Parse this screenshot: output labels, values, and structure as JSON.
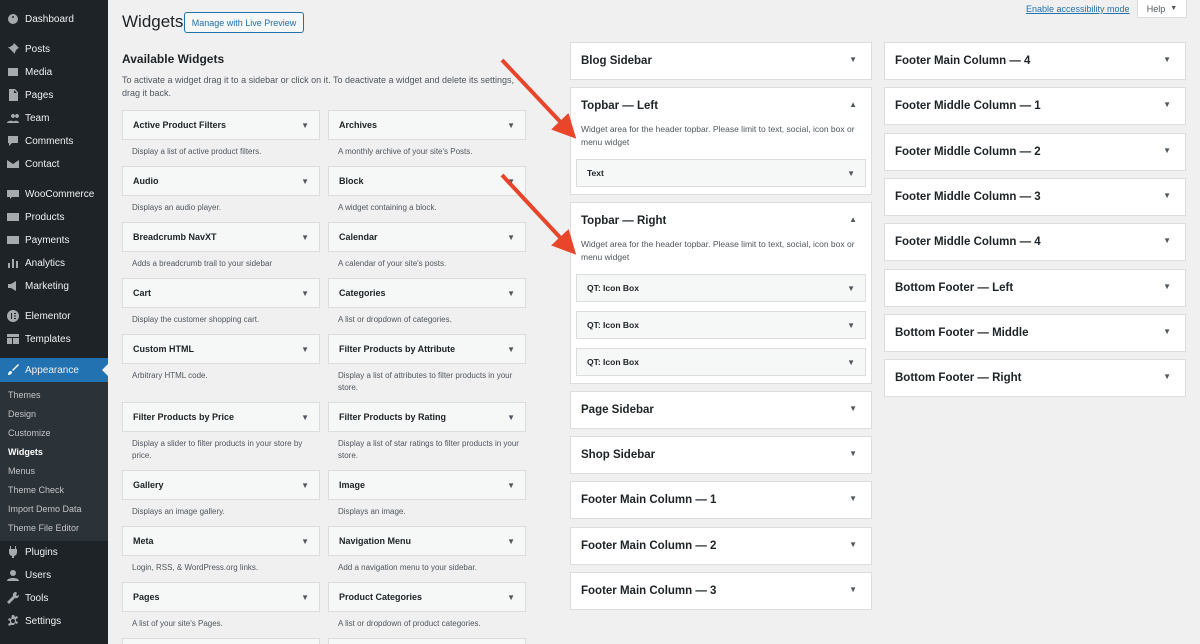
{
  "menu": {
    "items": [
      {
        "label": "Dashboard",
        "icon": "dashboard-icon"
      },
      {
        "label": "Posts",
        "icon": "pin-icon"
      },
      {
        "label": "Media",
        "icon": "media-icon"
      },
      {
        "label": "Pages",
        "icon": "pages-icon"
      },
      {
        "label": "Team",
        "icon": "team-icon"
      },
      {
        "label": "Comments",
        "icon": "comments-icon"
      },
      {
        "label": "Contact",
        "icon": "mail-icon"
      },
      {
        "label": "WooCommerce",
        "icon": "woocommerce-icon"
      },
      {
        "label": "Products",
        "icon": "products-icon"
      },
      {
        "label": "Payments",
        "icon": "payments-icon"
      },
      {
        "label": "Analytics",
        "icon": "analytics-icon"
      },
      {
        "label": "Marketing",
        "icon": "marketing-icon"
      },
      {
        "label": "Elementor",
        "icon": "elementor-icon"
      },
      {
        "label": "Templates",
        "icon": "templates-icon"
      },
      {
        "label": "Appearance",
        "icon": "brush-icon"
      },
      {
        "label": "Plugins",
        "icon": "plugins-icon"
      },
      {
        "label": "Users",
        "icon": "users-icon"
      },
      {
        "label": "Tools",
        "icon": "tools-icon"
      },
      {
        "label": "Settings",
        "icon": "settings-icon"
      }
    ],
    "submenu": [
      "Themes",
      "Design",
      "Customize",
      "Widgets",
      "Menus",
      "Theme Check",
      "Import Demo Data",
      "Theme File Editor"
    ]
  },
  "header": {
    "title": "Widgets",
    "live_preview": "Manage with Live Preview",
    "accessibility": "Enable accessibility mode",
    "help": "Help"
  },
  "available": {
    "title": "Available Widgets",
    "description": "To activate a widget drag it to a sidebar or click on it. To deactivate a widget and delete its settings, drag it back.",
    "widgets": [
      {
        "name": "Active Product Filters",
        "desc": "Display a list of active product filters."
      },
      {
        "name": "Archives",
        "desc": "A monthly archive of your site's Posts."
      },
      {
        "name": "Audio",
        "desc": "Displays an audio player."
      },
      {
        "name": "Block",
        "desc": "A widget containing a block."
      },
      {
        "name": "Breadcrumb NavXT",
        "desc": "Adds a breadcrumb trail to your sidebar"
      },
      {
        "name": "Calendar",
        "desc": "A calendar of your site's posts."
      },
      {
        "name": "Cart",
        "desc": "Display the customer shopping cart."
      },
      {
        "name": "Categories",
        "desc": "A list or dropdown of categories."
      },
      {
        "name": "Custom HTML",
        "desc": "Arbitrary HTML code."
      },
      {
        "name": "Filter Products by Attribute",
        "desc": "Display a list of attributes to filter products in your store."
      },
      {
        "name": "Filter Products by Price",
        "desc": "Display a slider to filter products in your store by price."
      },
      {
        "name": "Filter Products by Rating",
        "desc": "Display a list of star ratings to filter products in your store."
      },
      {
        "name": "Gallery",
        "desc": "Displays an image gallery."
      },
      {
        "name": "Image",
        "desc": "Displays an image."
      },
      {
        "name": "Meta",
        "desc": "Login, RSS, & WordPress.org links."
      },
      {
        "name": "Navigation Menu",
        "desc": "Add a navigation menu to your sidebar."
      },
      {
        "name": "Pages",
        "desc": "A list of your site's Pages."
      },
      {
        "name": "Product Categories",
        "desc": "A list or dropdown of product categories."
      }
    ]
  },
  "sidebars": {
    "blog": "Blog Sidebar",
    "topbar_left": {
      "title": "Topbar — Left",
      "desc": "Widget area for the header topbar. Please limit to text, social, icon box or menu widget",
      "widget": "Text"
    },
    "topbar_right": {
      "title": "Topbar — Right",
      "desc": "Widget area for the header topbar. Please limit to text, social, icon box or menu widget",
      "widgets": [
        "QT: Icon Box",
        "QT: Icon Box",
        "QT: Icon Box"
      ]
    },
    "col2": [
      "Page Sidebar",
      "Shop Sidebar",
      "Footer Main Column — 1",
      "Footer Main Column — 2",
      "Footer Main Column — 3"
    ],
    "col3": [
      "Footer Main Column — 4",
      "Footer Middle Column — 1",
      "Footer Middle Column — 2",
      "Footer Middle Column — 3",
      "Footer Middle Column — 4",
      "Bottom Footer — Left",
      "Bottom Footer — Middle",
      "Bottom Footer — Right"
    ]
  },
  "colors": {
    "accent": "#2271b1",
    "sidebar_bg": "#1d2327",
    "arrow": "#e8452a"
  }
}
